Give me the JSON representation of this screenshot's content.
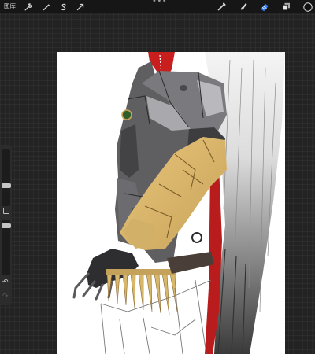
{
  "topbar": {
    "gallery_label": "图库",
    "more_label": "•••",
    "tools_left": [
      {
        "name": "actions-wrench-icon"
      },
      {
        "name": "adjustments-wand-icon"
      },
      {
        "name": "selection-s-icon"
      },
      {
        "name": "transform-arrow-icon"
      }
    ],
    "tools_right": [
      {
        "name": "brush-icon"
      },
      {
        "name": "smudge-icon"
      },
      {
        "name": "eraser-icon",
        "active": true
      },
      {
        "name": "layers-icon"
      },
      {
        "name": "color-swatch"
      }
    ]
  },
  "sidebar": {
    "undo_label": "↶",
    "redo_label": "↷"
  },
  "colors": {
    "toolbar_bg": "#161616",
    "canvas_bg": "#ffffff",
    "active_tool": "#2f7bf6",
    "armor_gray": "#5e5e60",
    "gauntlet_gold": "#d8b66a",
    "cape_red": "#c11d1d"
  }
}
